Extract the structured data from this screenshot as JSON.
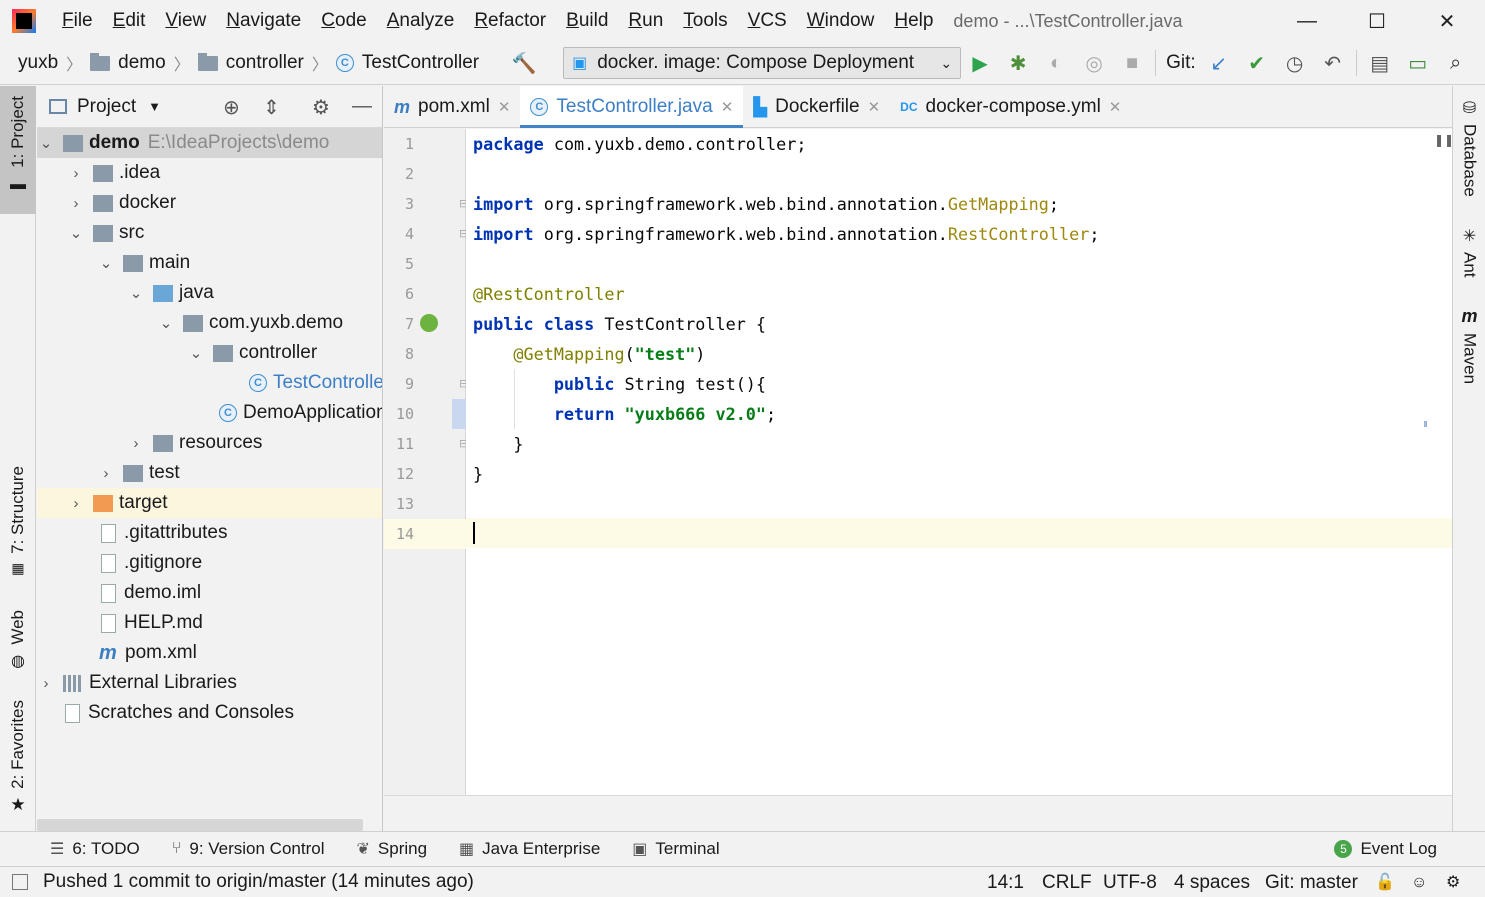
{
  "titlebar": {
    "menu": [
      "File",
      "Edit",
      "View",
      "Navigate",
      "Code",
      "Analyze",
      "Refactor",
      "Build",
      "Run",
      "Tools",
      "VCS",
      "Window",
      "Help"
    ],
    "window_title": "demo - ...\\TestController.java",
    "controls": {
      "minimize": "—",
      "maximize": "☐",
      "close": "✕"
    }
  },
  "navbar": {
    "breadcrumbs": [
      "yuxb",
      "demo",
      "controller",
      "TestController"
    ],
    "run_config": "docker.  image: Compose Deployment",
    "git_label": "Git:"
  },
  "left_strip": {
    "project": "1: Project",
    "structure": "7: Structure",
    "web": "Web",
    "favorites": "2: Favorites"
  },
  "right_strip": {
    "database": "Database",
    "ant": "Ant",
    "maven": "Maven"
  },
  "project_panel": {
    "title": "Project",
    "tree": [
      {
        "label": "demo",
        "path": "E:\\IdeaProjects\\demo"
      },
      {
        "label": ".idea"
      },
      {
        "label": "docker"
      },
      {
        "label": "src"
      },
      {
        "label": "main"
      },
      {
        "label": "java"
      },
      {
        "label": "com.yuxb.demo"
      },
      {
        "label": "controller"
      },
      {
        "label": "TestController"
      },
      {
        "label": "DemoApplication"
      },
      {
        "label": "resources"
      },
      {
        "label": "test"
      },
      {
        "label": "target"
      },
      {
        "label": ".gitattributes"
      },
      {
        "label": ".gitignore"
      },
      {
        "label": "demo.iml"
      },
      {
        "label": "HELP.md"
      },
      {
        "label": "pom.xml"
      },
      {
        "label": "External Libraries"
      },
      {
        "label": "Scratches and Consoles"
      }
    ]
  },
  "editor_tabs": [
    {
      "label": "pom.xml",
      "icon": "m"
    },
    {
      "label": "TestController.java",
      "icon": "C"
    },
    {
      "label": "Dockerfile",
      "icon": "docker-file-icon"
    },
    {
      "label": "docker-compose.yml",
      "icon": "dc"
    }
  ],
  "editor": {
    "line_numbers": [
      "1",
      "2",
      "3",
      "4",
      "5",
      "6",
      "7",
      "8",
      "9",
      "10",
      "11",
      "12",
      "13",
      "14"
    ],
    "lines": {
      "l1_kw": "package",
      "l1_rest": " com.yuxb.demo.controller;",
      "l3_kw": "import",
      "l3_rest": " org.springframework.web.bind.annotation.",
      "l3_cls": "GetMapping",
      "l3_end": ";",
      "l4_kw": "import",
      "l4_rest": " org.springframework.web.bind.annotation.",
      "l4_cls": "RestController",
      "l4_end": ";",
      "l6_ann": "@RestController",
      "l7_kw": "public class",
      "l7_rest": " TestController {",
      "l8_ann": "@GetMapping",
      "l8_open": "(",
      "l8_str": "\"test\"",
      "l8_close": ")",
      "l9_kw": "public",
      "l9_rest": " String test(){",
      "l10_kw": "return",
      "l10_str": " \"yuxb666 v2.0\"",
      "l10_end": ";",
      "l11": "}",
      "l12": "}"
    }
  },
  "bottom_tools": [
    {
      "label": "6: TODO",
      "icon": "☰"
    },
    {
      "label": "9: Version Control",
      "icon": "⑂"
    },
    {
      "label": "Spring",
      "icon": "❦"
    },
    {
      "label": "Java Enterprise",
      "icon": "▦"
    },
    {
      "label": "Terminal",
      "icon": "▣"
    },
    {
      "label": "Event Log",
      "icon": "5"
    }
  ],
  "statusbar": {
    "message": "Pushed 1 commit to origin/master (14 minutes ago)",
    "position": "14:1",
    "line_sep": "CRLF",
    "encoding": "UTF-8",
    "indent": "4 spaces",
    "branch": "Git: master"
  },
  "colors": {
    "accent": "#4083c9",
    "keyword": "#0033b3",
    "string": "#067d17",
    "annotation": "#9e880d"
  }
}
